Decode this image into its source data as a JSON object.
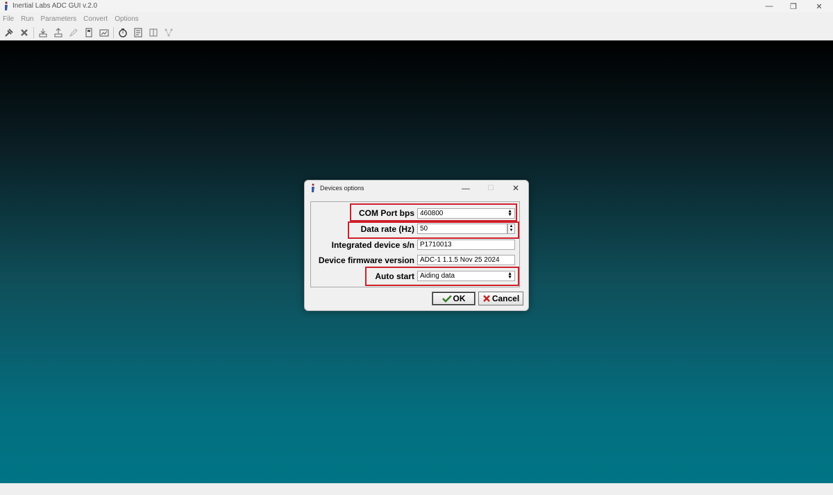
{
  "window": {
    "title": "Inertial Labs ADC GUI v.2.0",
    "controls": {
      "minimize": "—",
      "restore": "❐",
      "close": "✕"
    }
  },
  "menu": [
    "File",
    "Run",
    "Parameters",
    "Convert",
    "Options"
  ],
  "toolbar": {
    "icons": [
      "connect-icon",
      "disconnect-icon",
      "download-icon",
      "upload-icon",
      "edit-icon",
      "save-icon",
      "image-icon",
      "timer-icon",
      "document-icon",
      "layout-icon",
      "network-icon"
    ]
  },
  "dialog": {
    "title": "Devices options",
    "controls": {
      "minimize": "—",
      "maximize": "☐",
      "close": "✕"
    },
    "fields": {
      "com_port": {
        "label": "COM Port bps",
        "value": "460800"
      },
      "data_rate": {
        "label": "Data rate (Hz)",
        "value": "50"
      },
      "serial": {
        "label": "Integrated device s/n",
        "value": "P1710013"
      },
      "firmware": {
        "label": "Device firmware version",
        "value": "ADC-1 1.1.5 Nov 25 2024"
      },
      "auto_start": {
        "label": "Auto start",
        "value": "Aiding data"
      }
    },
    "buttons": {
      "ok": "OK",
      "cancel": "Cancel"
    }
  },
  "colors": {
    "highlight": "#d01f2b",
    "gradient_top": "#000000",
    "gradient_bottom": "#007585"
  }
}
